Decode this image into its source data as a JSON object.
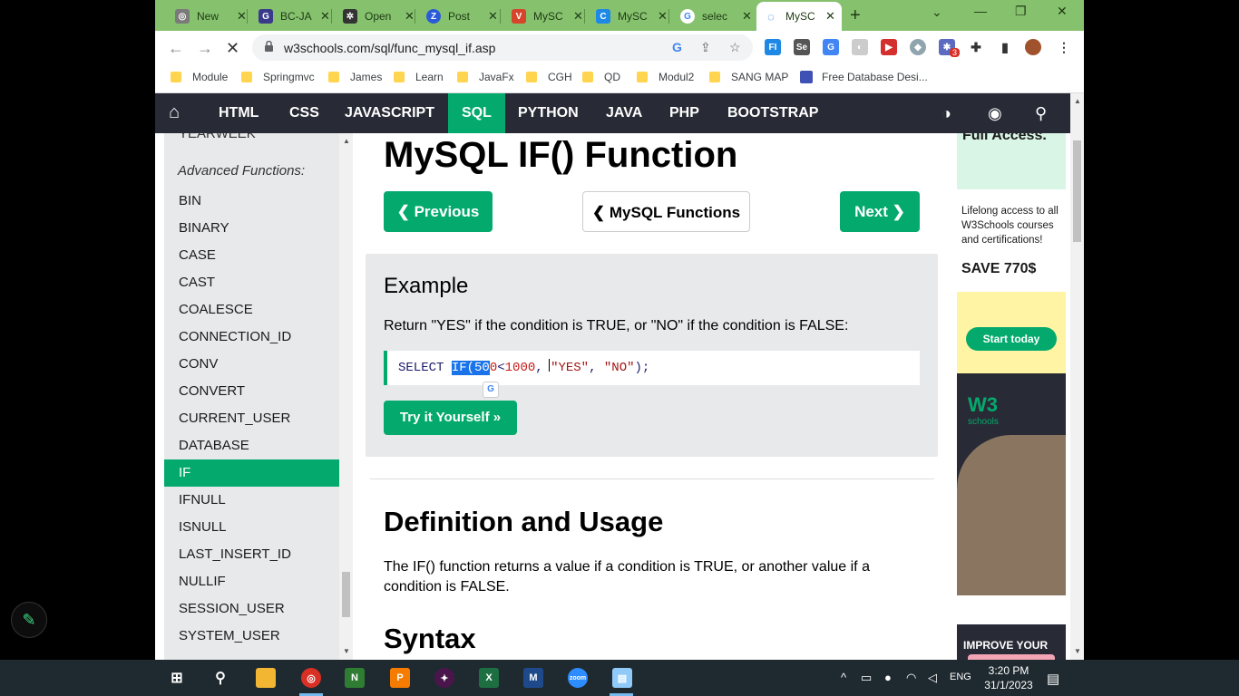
{
  "browser": {
    "tabs": [
      {
        "label": "New",
        "favicon": "chrome-icon"
      },
      {
        "label": "BC-JA",
        "favicon": "g-icon"
      },
      {
        "label": "Open",
        "favicon": "openai-icon"
      },
      {
        "label": "Post",
        "favicon": "z-icon"
      },
      {
        "label": "MySC",
        "favicon": "v-icon"
      },
      {
        "label": "MySC",
        "favicon": "c-icon"
      },
      {
        "label": "selec",
        "favicon": "google-icon"
      },
      {
        "label": "MySC",
        "favicon": "loading-icon"
      }
    ],
    "url": "w3schools.com/sql/func_mysql_if.asp",
    "bookmarks": [
      "Module",
      "Springmvc",
      "James",
      "Learn",
      "JavaFx",
      "CGH",
      "QD",
      "Modul2",
      "SANG MAP",
      "Free Database Desi..."
    ],
    "extension_badge": "3"
  },
  "nav": {
    "items": [
      "HTML",
      "CSS",
      "JAVASCRIPT",
      "SQL",
      "PYTHON",
      "JAVA",
      "PHP",
      "BOOTSTRAP"
    ],
    "active": "SQL"
  },
  "sidebar": {
    "truncated_item": "YEARWEEK",
    "heading": "Advanced Functions:",
    "items": [
      "BIN",
      "BINARY",
      "CASE",
      "CAST",
      "COALESCE",
      "CONNECTION_ID",
      "CONV",
      "CONVERT",
      "CURRENT_USER",
      "DATABASE",
      "IF",
      "IFNULL",
      "ISNULL",
      "LAST_INSERT_ID",
      "NULLIF",
      "SESSION_USER",
      "SYSTEM_USER"
    ],
    "active": "IF"
  },
  "main": {
    "title": "MySQL IF() Function",
    "prev_label": "❮ Previous",
    "functions_label": "❮ MySQL Functions",
    "next_label": "Next ❯",
    "example": {
      "title": "Example",
      "description": "Return \"YES\" if the condition is TRUE, or \"NO\" if the condition is FALSE:",
      "code": {
        "kw": "SELECT ",
        "sel": "IF(50",
        "rest1": "0",
        "op": "<",
        "num": "1000",
        "comma1": ", ",
        "s1": "\"YES\"",
        "comma2": ", ",
        "s2": "\"NO\"",
        "end": ");"
      },
      "try_label": "Try it Yourself »"
    },
    "definition_heading": "Definition and Usage",
    "definition_text": "The IF() function returns a value if a condition is TRUE, or another value if a condition is FALSE.",
    "syntax_heading": "Syntax"
  },
  "ad": {
    "headline": "Full Access.",
    "lifelong": "Lifelong access to all W3Schools courses and certifications!",
    "save": "SAVE 770$",
    "cta": "Start today",
    "logo": "W3",
    "logo_sub": "schools",
    "bottom_text": "IMPROVE YOUR"
  },
  "taskbar": {
    "time": "3:20 PM",
    "date": "31/1/2023",
    "lang": "ENG"
  }
}
